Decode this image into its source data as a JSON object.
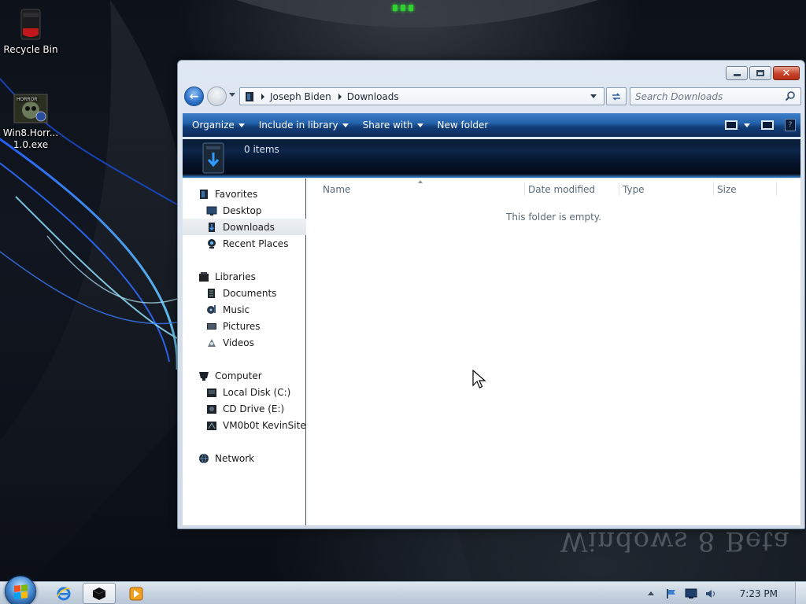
{
  "desktop": {
    "icons": [
      {
        "label": "Recycle Bin"
      },
      {
        "label_line1": "Win8.Horr...",
        "label_line2": "1.0.exe",
        "badge_text": "HORROR"
      }
    ],
    "wallpaper_text": "Windows 8 Beta"
  },
  "window": {
    "address": {
      "segments": [
        "Joseph Biden",
        "Downloads"
      ]
    },
    "search": {
      "placeholder": "Search Downloads"
    },
    "command_bar": {
      "organize": "Organize",
      "include_in_library": "Include in library",
      "share_with": "Share with",
      "new_folder": "New folder"
    },
    "details": {
      "item_count": "0 items"
    },
    "nav_pane": {
      "favorites": {
        "label": "Favorites",
        "items": [
          "Desktop",
          "Downloads",
          "Recent Places"
        ]
      },
      "libraries": {
        "label": "Libraries",
        "items": [
          "Documents",
          "Music",
          "Pictures",
          "Videos"
        ]
      },
      "computer": {
        "label": "Computer",
        "items": [
          "Local Disk (C:)",
          "CD Drive (E:)",
          "VM0b0t KevinSite"
        ]
      },
      "network": {
        "label": "Network"
      },
      "selected": "Downloads"
    },
    "columns": [
      "Name",
      "Date modified",
      "Type",
      "Size"
    ],
    "empty_message": "This folder is empty."
  },
  "taskbar": {
    "clock": "7:23 PM"
  },
  "colors": {
    "command_bar_top": "#3c7fc8",
    "command_bar_bottom": "#0d2a58",
    "close_button": "#c8432a",
    "taskbar": "#c8d4e0"
  }
}
